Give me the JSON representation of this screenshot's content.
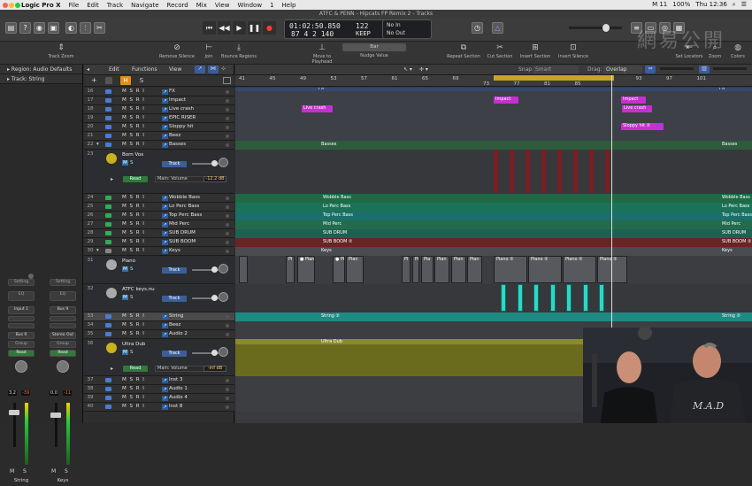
{
  "menubar": {
    "app": "Logic Pro X",
    "items": [
      "File",
      "Edit",
      "Track",
      "Navigate",
      "Record",
      "Mix",
      "View",
      "Window",
      "1",
      "Help"
    ],
    "status": [
      "M 11",
      "100%",
      "Thu 12:36"
    ]
  },
  "window": {
    "title": "ATFC & PENN - Hipcats FP Remix 2 - Tracks"
  },
  "lcd": {
    "time": "01:02:50.850",
    "bars": "87  4  2  140",
    "tempo": "122",
    "keep": "KEEP",
    "in": "No In",
    "out": "No Out"
  },
  "toolbar": {
    "left_tool": "Track Zoom",
    "items": [
      "Remove Silence",
      "Join",
      "Bounce Regions",
      "Move to Playhead",
      "Nudge Value",
      "Repeat Section",
      "Cut Section",
      "Insert Section",
      "Insert Silence",
      "Set Locators",
      "Zoom",
      "Colors"
    ],
    "nudge_value": "Bar"
  },
  "inspector": {
    "region_row": "Region: Audio Defaults",
    "track_row": "Track: String",
    "strip1": {
      "setting": "Setting",
      "eq": "EQ",
      "input": "Input 1",
      "bus": "Bus 9",
      "group": "Group",
      "read": "Read",
      "val1": "3.2",
      "val2": "-39",
      "m": "M",
      "s": "S",
      "name": "String"
    },
    "strip2": {
      "setting": "Setting",
      "eq": "EQ",
      "input": "Bus 9",
      "output": "Stereo Out",
      "group": "Group",
      "read": "Read",
      "val1": "0.0",
      "val2": "-11",
      "m": "M",
      "s": "S",
      "name": "Keys"
    }
  },
  "tracklist": {
    "edit": "Edit",
    "functions": "Functions",
    "view": "View",
    "h": "H",
    "s": "S",
    "tracks": [
      {
        "num": "16",
        "name": "FX"
      },
      {
        "num": "17",
        "name": "Impact"
      },
      {
        "num": "18",
        "name": "Live crash"
      },
      {
        "num": "19",
        "name": "EPIC RISER"
      },
      {
        "num": "20",
        "name": "Sloppy hit"
      },
      {
        "num": "21",
        "name": "Beez"
      },
      {
        "num": "22",
        "name": "Basses"
      },
      {
        "num": "23",
        "name": "Born Vox"
      },
      {
        "num": "24",
        "name": "Wobble Bass"
      },
      {
        "num": "25",
        "name": "Lo Perc Bass"
      },
      {
        "num": "26",
        "name": "Top Perc Bass"
      },
      {
        "num": "27",
        "name": "Mid Perc"
      },
      {
        "num": "28",
        "name": "SUB DRUM"
      },
      {
        "num": "29",
        "name": "SUB BOOM"
      },
      {
        "num": "30",
        "name": "Keys"
      },
      {
        "num": "31",
        "name": "Piano"
      },
      {
        "num": "32",
        "name": "ATFC keys.nu"
      },
      {
        "num": "33",
        "name": "String"
      },
      {
        "num": "34",
        "name": "Beez"
      },
      {
        "num": "35",
        "name": "Audio 2"
      },
      {
        "num": "36",
        "name": "Ultra Dub"
      },
      {
        "num": "37",
        "name": "Inst 3"
      },
      {
        "num": "38",
        "name": "Audio 1"
      },
      {
        "num": "39",
        "name": "Audio 4"
      },
      {
        "num": "40",
        "name": "Inst 8"
      }
    ],
    "track_btn": "Track",
    "read": "Read",
    "main_volume": "Main: Volume",
    "vol_born": "-12.2 dB",
    "vol_ultra": "-inf dB"
  },
  "arrange": {
    "snap_label": "Snap:",
    "snap": "Smart",
    "drag_label": "Drag:",
    "drag": "Overlap",
    "ruler": [
      "41",
      "45",
      "49",
      "53",
      "57",
      "61",
      "65",
      "69",
      "73",
      "77",
      "81",
      "85",
      "89",
      "93",
      "97",
      "101"
    ],
    "regions": {
      "fx": "FX",
      "impact": "Impact",
      "live_crash": "Live crash",
      "sloppy": "Sloppy hit",
      "basses": "Basses",
      "wobble": "Wobble Bass",
      "lo_perc": "Lo Perc Bass",
      "top_perc": "Top Perc Bass",
      "mid_perc": "Mid Perc",
      "sub_drum": "SUB DRUM",
      "sub_boom": "SUB BOOM",
      "keys": "Keys",
      "piano": "Piano",
      "pi": "Pi",
      "pia": "Pia",
      "pian": "Pian",
      "string": "String",
      "ultra_dub": "Ultra Dub"
    }
  },
  "watermark": "網易公開"
}
